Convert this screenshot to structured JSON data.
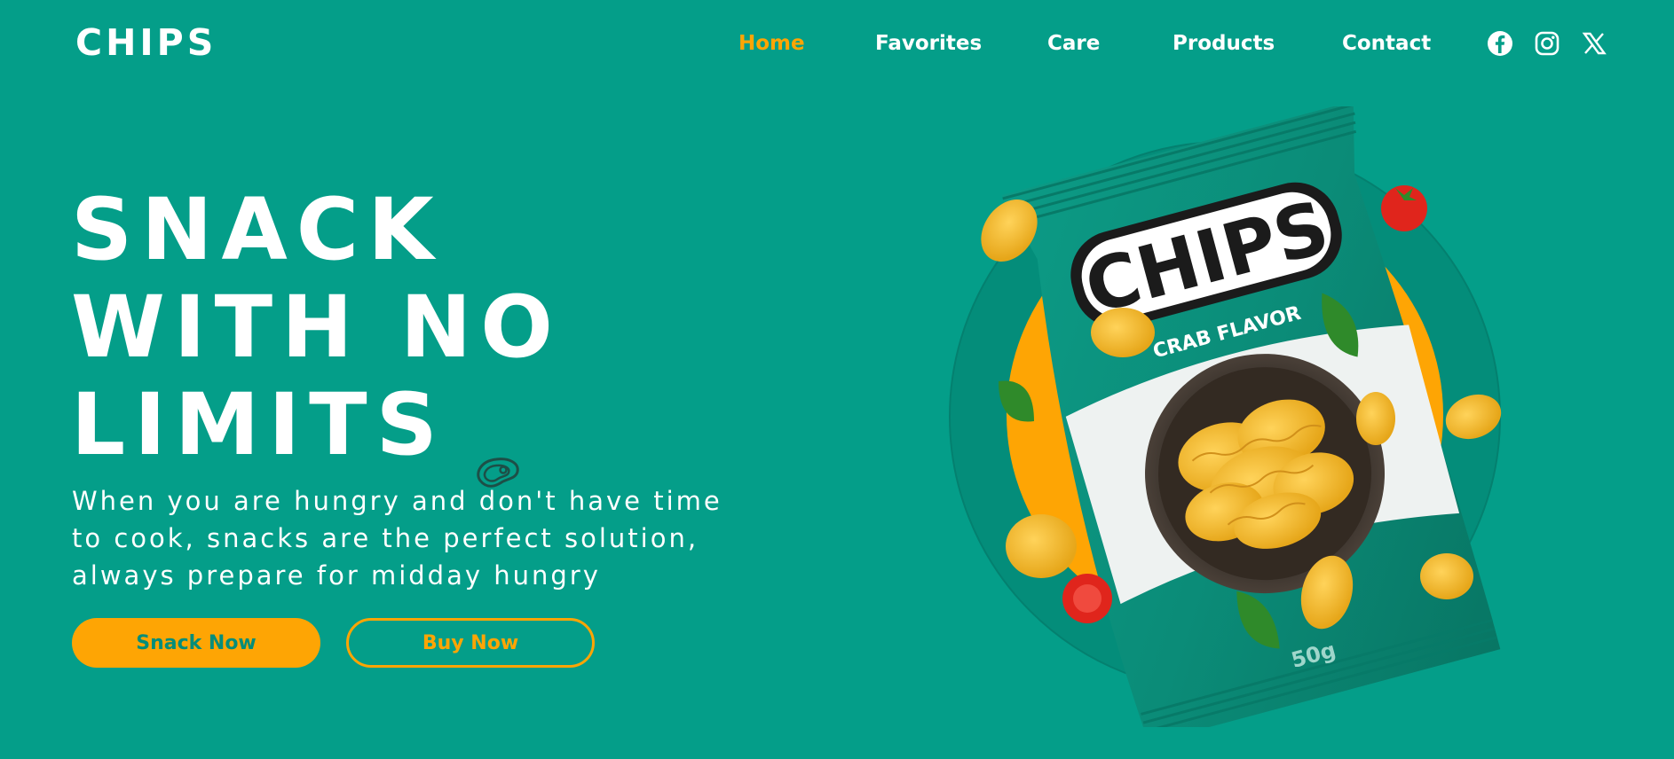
{
  "brand": {
    "name": "CHIPS"
  },
  "nav": {
    "items": [
      {
        "label": "Home",
        "active": true
      },
      {
        "label": "Favorites",
        "active": false
      },
      {
        "label": "Care",
        "active": false
      },
      {
        "label": "Products",
        "active": false
      },
      {
        "label": "Contact",
        "active": false
      }
    ]
  },
  "social": [
    "facebook-icon",
    "instagram-icon",
    "x-icon"
  ],
  "hero": {
    "headline": [
      "SNACK",
      "WITH NO",
      "LIMITS"
    ],
    "description": "When you are hungry and don't have time to cook, snacks are the perfect solution, always prepare for midday hungry",
    "primary_button": "Snack Now",
    "secondary_button": "Buy Now"
  },
  "package": {
    "brand": "CHIPS",
    "flavor": "CRAB FLAVOR",
    "weight": "50g"
  },
  "colors": {
    "background": "#049e89",
    "accent": "#fea504",
    "text": "#ffffff",
    "package": "#0b8f7c"
  }
}
